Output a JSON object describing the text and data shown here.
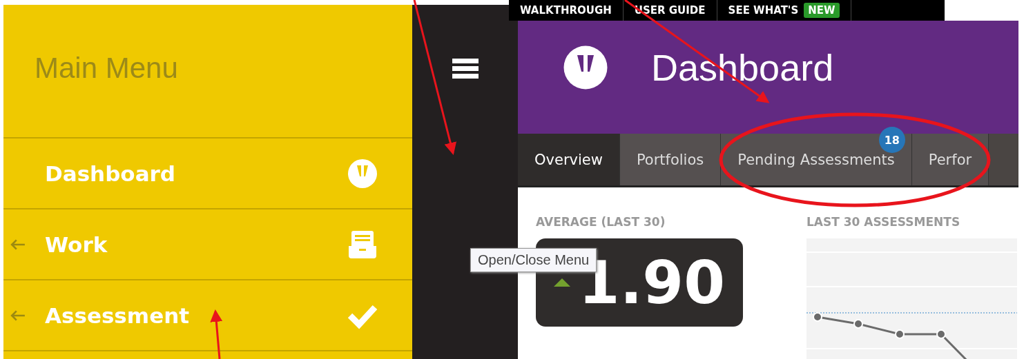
{
  "top_links": [
    {
      "label": "WALKTHROUGH"
    },
    {
      "label": "USER GUIDE"
    },
    {
      "label": "SEE WHAT'S",
      "badge": "NEW"
    }
  ],
  "main_menu": {
    "title": "Main Menu",
    "items": [
      {
        "label": "Dashboard",
        "expandable": false
      },
      {
        "label": "Work",
        "expandable": true
      },
      {
        "label": "Assessment",
        "expandable": true
      }
    ]
  },
  "tooltip": "Open/Close Menu",
  "header": {
    "title": "Dashboard"
  },
  "tabs": [
    {
      "label": "Overview",
      "selected": true
    },
    {
      "label": "Portfolios",
      "selected": false
    },
    {
      "label": "Pending Assessments",
      "selected": false,
      "badge": "18"
    },
    {
      "label": "Perfor",
      "selected": false
    }
  ],
  "average": {
    "label": "AVERAGE (LAST 30)",
    "value": "1.90"
  },
  "chart": {
    "title": "LAST 30 ASSESSMENTS"
  }
}
